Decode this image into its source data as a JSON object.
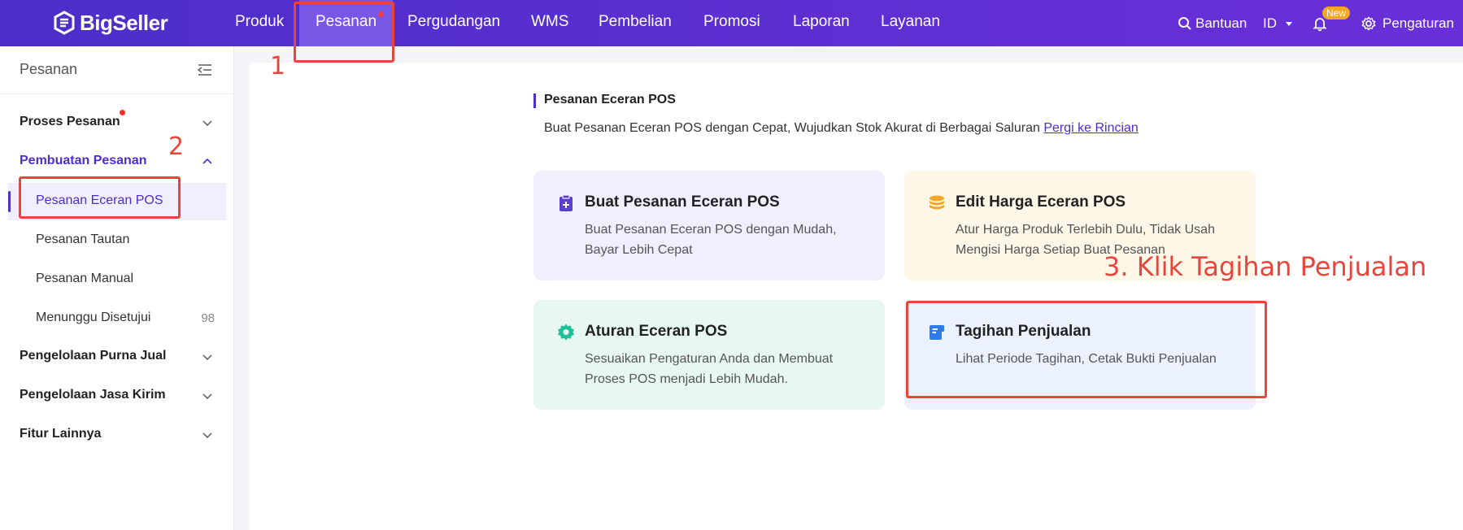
{
  "brand": {
    "name": "BigSeller",
    "accent": "#4b2fc8"
  },
  "topnav": {
    "items": [
      {
        "label": "Produk"
      },
      {
        "label": "Pesanan",
        "active": true,
        "has_dot": true
      },
      {
        "label": "Pergudangan"
      },
      {
        "label": "WMS"
      },
      {
        "label": "Pembelian"
      },
      {
        "label": "Promosi"
      },
      {
        "label": "Laporan"
      },
      {
        "label": "Layanan"
      }
    ],
    "help_label": "Bantuan",
    "language": "ID",
    "new_badge": "New",
    "settings_label": "Pengaturan"
  },
  "sidebar": {
    "title": "Pesanan",
    "groups": [
      {
        "label": "Proses Pesanan",
        "has_dot": true
      },
      {
        "label": "Pembuatan Pesanan",
        "open": true
      },
      {
        "label": "Pengelolaan Purna Jual"
      },
      {
        "label": "Pengelolaan Jasa Kirim"
      },
      {
        "label": "Fitur Lainnya"
      }
    ],
    "items": [
      {
        "label": "Pesanan Eceran POS",
        "active": true
      },
      {
        "label": "Pesanan Tautan"
      },
      {
        "label": "Pesanan Manual"
      },
      {
        "label": "Menunggu Disetujui",
        "count": "98"
      }
    ]
  },
  "main": {
    "section_title": "Pesanan Eceran POS",
    "section_desc": "Buat Pesanan Eceran POS dengan Cepat, Wujudkan Stok Akurat di Berbagai Saluran ",
    "section_link": "Pergi ke Rincian",
    "cards": [
      {
        "title": "Buat Pesanan Eceran POS",
        "desc": "Buat Pesanan Eceran POS dengan Mudah, Bayar Lebih Cepat",
        "icon": "clipboard-plus-icon",
        "bg": "#f1eefd",
        "icon_color": "#5b3fd1"
      },
      {
        "title": "Edit Harga Eceran POS",
        "desc": "Atur Harga Produk Terlebih Dulu, Tidak Usah Mengisi Harga Setiap Buat Pesanan",
        "icon": "coins-icon",
        "bg": "#fef6e6",
        "icon_color": "#f5a623"
      },
      {
        "title": "Aturan Eceran POS",
        "desc": "Sesuaikan Pengaturan Anda dan Membuat Proses POS menjadi Lebih Mudah.",
        "icon": "gear-icon",
        "bg": "#e7f8f3",
        "icon_color": "#1fbf97"
      },
      {
        "title": "Tagihan Penjualan",
        "desc": "Lihat Periode Tagihan, Cetak Bukti Penjualan",
        "icon": "receipt-icon",
        "bg": "#ebf2fd",
        "icon_color": "#2f7be8"
      }
    ]
  },
  "annotations": {
    "step1": "1",
    "step2": "2",
    "step3": "3. Klik Tagihan Penjualan",
    "color": "#e8453c"
  }
}
